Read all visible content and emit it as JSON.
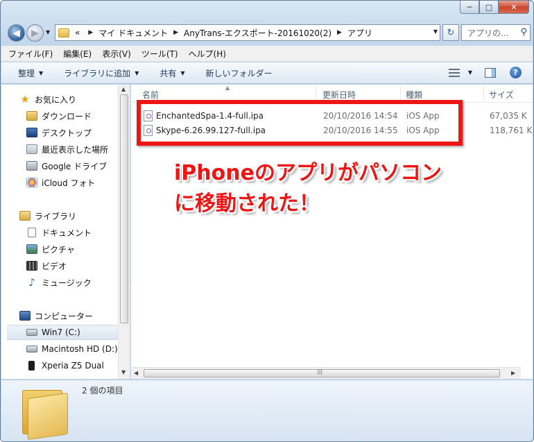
{
  "window": {
    "caption_min": "─",
    "caption_max": "□",
    "caption_close": "✕"
  },
  "nav": {
    "back_glyph": "◀",
    "forward_glyph": "▶",
    "refresh_glyph": "↻"
  },
  "address": {
    "overflow": "«",
    "sep": "▶",
    "crumbs": [
      "マイ ドキュメント",
      "AnyTrans-エクスポート-20161020(2)",
      "アプリ"
    ]
  },
  "search": {
    "placeholder": "アプリの...",
    "icon": "search-icon"
  },
  "menubar": [
    "ファイル(F)",
    "編集(E)",
    "表示(V)",
    "ツール(T)",
    "ヘルプ(H)"
  ],
  "toolbar": {
    "organize": "整理",
    "library": "ライブラリに追加",
    "share": "共有",
    "new_folder": "新しいフォルダー",
    "help": "?"
  },
  "sidebar": {
    "favorites": "お気に入り",
    "downloads": "ダウンロード",
    "desktop": "デスクトップ",
    "recent": "最近表示した場所",
    "gdrive": "Google ドライブ",
    "icloud": "iCloud フォト",
    "libraries": "ライブラリ",
    "documents": "ドキュメント",
    "pictures": "ピクチャ",
    "videos": "ビデオ",
    "music": "ミュージック",
    "computer": "コンピューター",
    "drive_c": "Win7 (C:)",
    "drive_d": "Macintosh HD (D:)",
    "xperia": "Xperia Z5 Dual"
  },
  "columns": {
    "name": "名前",
    "date": "更新日時",
    "type": "種類",
    "size": "サイズ"
  },
  "files": [
    {
      "name": "EnchantedSpa-1.4-full.ipa",
      "date": "20/10/2016 14:54",
      "type": "iOS App",
      "size": "67,035 K"
    },
    {
      "name": "Skype-6.26.99.127-full.ipa",
      "date": "20/10/2016 14:55",
      "type": "iOS App",
      "size": "118,761 K"
    }
  ],
  "annotation": {
    "line1": "iPhoneのアプリがパソコン",
    "line2": "に移動された！",
    "color": "#ee1515"
  },
  "details": {
    "item_count": "2 個の項目"
  }
}
